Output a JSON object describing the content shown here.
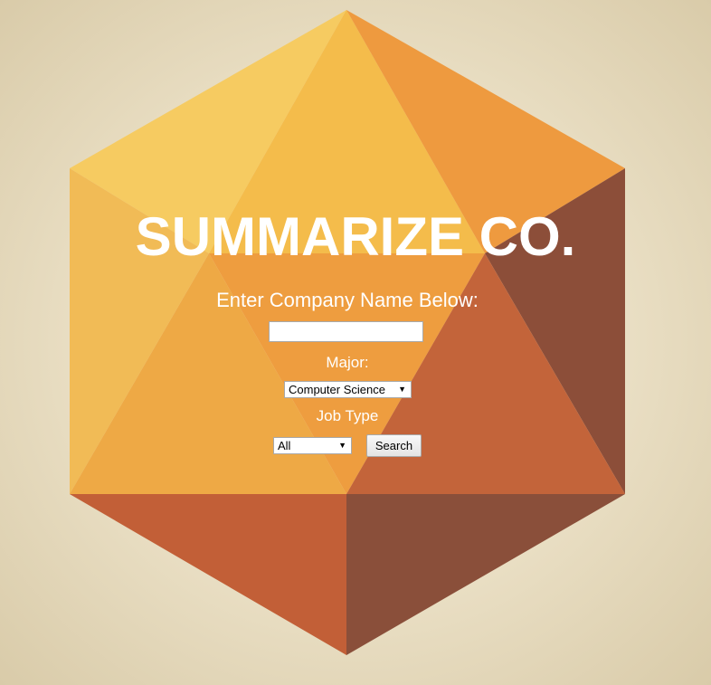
{
  "hero": {
    "title": "SUMMARIZE CO.",
    "company_prompt": "Enter Company Name Below:"
  },
  "form": {
    "company_input": {
      "value": "",
      "placeholder": ""
    },
    "major_label": "Major:",
    "major_select": {
      "selected": "Computer Science"
    },
    "job_type_label": "Job Type",
    "job_type_select": {
      "selected": "All"
    },
    "search_label": "Search"
  },
  "colors": {
    "background": "#e9dec3",
    "text": "#ffffff",
    "hexagon_light_yellow": "#f4c75c",
    "hexagon_orange": "#ee9a40",
    "hexagon_burnt_orange": "#c2603a",
    "hexagon_brown": "#8b4f3a"
  }
}
